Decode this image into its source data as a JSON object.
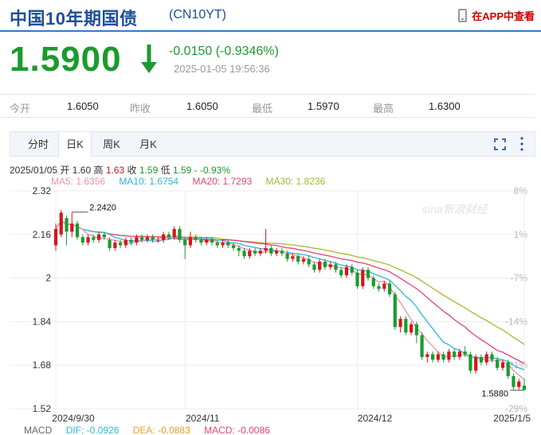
{
  "header": {
    "title": "中国10年期国债",
    "code": "(CN10YT)",
    "app_link": "在APP中查看"
  },
  "quote": {
    "price": "1.5900",
    "direction": "down",
    "change": "-0.0150 (-0.9346%)",
    "timestamp": "2025-01-05 19:56:36"
  },
  "stats": [
    {
      "label": "今开",
      "value": "1.6050"
    },
    {
      "label": "昨收",
      "value": "1.6050"
    },
    {
      "label": "最低",
      "value": "1.5970"
    },
    {
      "label": "最高",
      "value": "1.6300"
    }
  ],
  "tabs": [
    {
      "label": "分时",
      "active": false
    },
    {
      "label": "日K",
      "active": true
    },
    {
      "label": "周K",
      "active": false
    },
    {
      "label": "月K",
      "active": false
    }
  ],
  "ohlc_line": {
    "date": "2025/01/05",
    "open_label": "开",
    "open": "1.60",
    "high_label": "高",
    "high": "1.63",
    "close_label": "收",
    "close": "1.59",
    "low_label": "低",
    "low": "1.59",
    "change": "- -0.93%"
  },
  "ma_legend": [
    {
      "text": "MA5: 1.6356",
      "color": "#f08fb0"
    },
    {
      "text": "MA10: 1.6754",
      "color": "#2fb4dc"
    },
    {
      "text": "MA20: 1.7293",
      "color": "#e0447a"
    },
    {
      "text": "MA30: 1.8236",
      "color": "#a9b72e"
    }
  ],
  "macd_legend": [
    {
      "text": "MACD",
      "color": "#666666"
    },
    {
      "text": "DIF: -0.0926",
      "color": "#2fb4dc"
    },
    {
      "text": "DEA: -0.0883",
      "color": "#e8a02e"
    },
    {
      "text": "MACD: -0.0086",
      "color": "#e0447a"
    }
  ],
  "watermark": "sina新浪财经",
  "colors": {
    "up": "#d6161c",
    "down": "#1a9b2c",
    "brand": "#1f4e96",
    "ma5": "#f08fb0",
    "ma10": "#2fb4dc",
    "ma20": "#e0447a",
    "ma30": "#a9b72e"
  },
  "icons": {
    "app": "phone-icon",
    "trend": "arrow-down-icon",
    "fullscreen": "fullscreen-icon",
    "menu": "more-vertical-icon"
  },
  "chart_data": {
    "type": "candlestick",
    "ylim": [
      1.52,
      2.32
    ],
    "y_ticks": [
      "2.32",
      "2.16",
      "2",
      "1.84",
      "1.68",
      "1.52"
    ],
    "y_tick_values": [
      2.32,
      2.16,
      2.0,
      1.84,
      1.68,
      1.52
    ],
    "pct_ticks": [
      "8%",
      "1%",
      "-7%",
      "-14%",
      "-21%",
      "-29%"
    ],
    "x_ticks": [
      "2024/9/30",
      "2024/11",
      "2024/12",
      "2025/1/5"
    ],
    "x_tick_index": [
      0,
      24,
      56,
      87
    ],
    "annotations": [
      {
        "label": "2.2420",
        "index": 3,
        "value": 2.242
      },
      {
        "label": "1.5880",
        "index": 87,
        "value": 1.588
      }
    ],
    "candles": [
      [
        2.12,
        2.18,
        2.2,
        2.1
      ],
      [
        2.16,
        2.24,
        2.25,
        2.15
      ],
      [
        2.22,
        2.17,
        2.23,
        2.12
      ],
      [
        2.17,
        2.2,
        2.242,
        2.15
      ],
      [
        2.2,
        2.15,
        2.21,
        2.14
      ],
      [
        2.15,
        2.13,
        2.16,
        2.12
      ],
      [
        2.13,
        2.15,
        2.16,
        2.12
      ],
      [
        2.15,
        2.14,
        2.16,
        2.13
      ],
      [
        2.14,
        2.16,
        2.17,
        2.13
      ],
      [
        2.16,
        2.15,
        2.17,
        2.14
      ],
      [
        2.14,
        2.11,
        2.15,
        2.1
      ],
      [
        2.11,
        2.13,
        2.14,
        2.1
      ],
      [
        2.13,
        2.12,
        2.14,
        2.11
      ],
      [
        2.12,
        2.14,
        2.15,
        2.11
      ],
      [
        2.14,
        2.13,
        2.15,
        2.12
      ],
      [
        2.13,
        2.15,
        2.16,
        2.12
      ],
      [
        2.15,
        2.14,
        2.16,
        2.13
      ],
      [
        2.14,
        2.15,
        2.16,
        2.13
      ],
      [
        2.15,
        2.14,
        2.16,
        2.13
      ],
      [
        2.14,
        2.14,
        2.15,
        2.13
      ],
      [
        2.14,
        2.16,
        2.17,
        2.13
      ],
      [
        2.16,
        2.15,
        2.17,
        2.14
      ],
      [
        2.15,
        2.18,
        2.19,
        2.14
      ],
      [
        2.18,
        2.14,
        2.19,
        2.13
      ],
      [
        2.14,
        2.12,
        2.15,
        2.07
      ],
      [
        2.12,
        2.15,
        2.17,
        2.11
      ],
      [
        2.15,
        2.14,
        2.16,
        2.13
      ],
      [
        2.14,
        2.13,
        2.15,
        2.12
      ],
      [
        2.13,
        2.14,
        2.15,
        2.12
      ],
      [
        2.14,
        2.13,
        2.15,
        2.12
      ],
      [
        2.13,
        2.12,
        2.14,
        2.11
      ],
      [
        2.12,
        2.13,
        2.14,
        2.11
      ],
      [
        2.13,
        2.12,
        2.14,
        2.11
      ],
      [
        2.12,
        2.11,
        2.13,
        2.1
      ],
      [
        2.11,
        2.1,
        2.12,
        2.08
      ],
      [
        2.1,
        2.08,
        2.11,
        2.07
      ],
      [
        2.08,
        2.1,
        2.11,
        2.07
      ],
      [
        2.1,
        2.09,
        2.11,
        2.08
      ],
      [
        2.09,
        2.1,
        2.11,
        2.08
      ],
      [
        2.1,
        2.11,
        2.18,
        2.09
      ],
      [
        2.11,
        2.09,
        2.12,
        2.08
      ],
      [
        2.09,
        2.1,
        2.11,
        2.08
      ],
      [
        2.1,
        2.09,
        2.11,
        2.08
      ],
      [
        2.09,
        2.07,
        2.1,
        2.06
      ],
      [
        2.07,
        2.08,
        2.09,
        2.06
      ],
      [
        2.08,
        2.06,
        2.09,
        2.05
      ],
      [
        2.06,
        2.07,
        2.08,
        2.05
      ],
      [
        2.07,
        2.05,
        2.08,
        2.04
      ],
      [
        2.05,
        2.03,
        2.06,
        2.02
      ],
      [
        2.03,
        2.06,
        2.07,
        2.02
      ],
      [
        2.06,
        2.04,
        2.07,
        2.03
      ],
      [
        2.04,
        2.05,
        2.06,
        2.03
      ],
      [
        2.05,
        2.03,
        2.06,
        2.02
      ],
      [
        2.03,
        2.01,
        2.04,
        2.0
      ],
      [
        2.01,
        2.04,
        2.05,
        2.0
      ],
      [
        2.04,
        2.02,
        2.05,
        2.01
      ],
      [
        2.02,
        1.97,
        2.03,
        1.96
      ],
      [
        1.97,
        2.03,
        2.04,
        1.96
      ],
      [
        2.03,
        2.0,
        2.04,
        1.99
      ],
      [
        2.0,
        1.97,
        2.01,
        1.96
      ],
      [
        1.97,
        1.96,
        1.98,
        1.95
      ],
      [
        1.96,
        1.98,
        1.99,
        1.95
      ],
      [
        1.98,
        1.94,
        1.99,
        1.93
      ],
      [
        1.94,
        1.82,
        1.95,
        1.81
      ],
      [
        1.82,
        1.85,
        1.86,
        1.8
      ],
      [
        1.85,
        1.8,
        1.86,
        1.79
      ],
      [
        1.8,
        1.83,
        1.84,
        1.79
      ],
      [
        1.83,
        1.79,
        1.84,
        1.76
      ],
      [
        1.79,
        1.71,
        1.8,
        1.7
      ],
      [
        1.71,
        1.72,
        1.73,
        1.69
      ],
      [
        1.72,
        1.7,
        1.73,
        1.69
      ],
      [
        1.7,
        1.72,
        1.73,
        1.69
      ],
      [
        1.72,
        1.7,
        1.73,
        1.69
      ],
      [
        1.7,
        1.73,
        1.74,
        1.69
      ],
      [
        1.73,
        1.71,
        1.74,
        1.7
      ],
      [
        1.71,
        1.73,
        1.74,
        1.7
      ],
      [
        1.73,
        1.72,
        1.75,
        1.71
      ],
      [
        1.72,
        1.66,
        1.73,
        1.65
      ],
      [
        1.66,
        1.71,
        1.72,
        1.65
      ],
      [
        1.71,
        1.69,
        1.72,
        1.68
      ],
      [
        1.69,
        1.72,
        1.73,
        1.68
      ],
      [
        1.72,
        1.7,
        1.73,
        1.69
      ],
      [
        1.7,
        1.67,
        1.71,
        1.66
      ],
      [
        1.67,
        1.69,
        1.7,
        1.66
      ],
      [
        1.69,
        1.64,
        1.7,
        1.63
      ],
      [
        1.64,
        1.6,
        1.65,
        1.59
      ],
      [
        1.6,
        1.62,
        1.63,
        1.59
      ],
      [
        1.605,
        1.59,
        1.63,
        1.588
      ]
    ]
  }
}
